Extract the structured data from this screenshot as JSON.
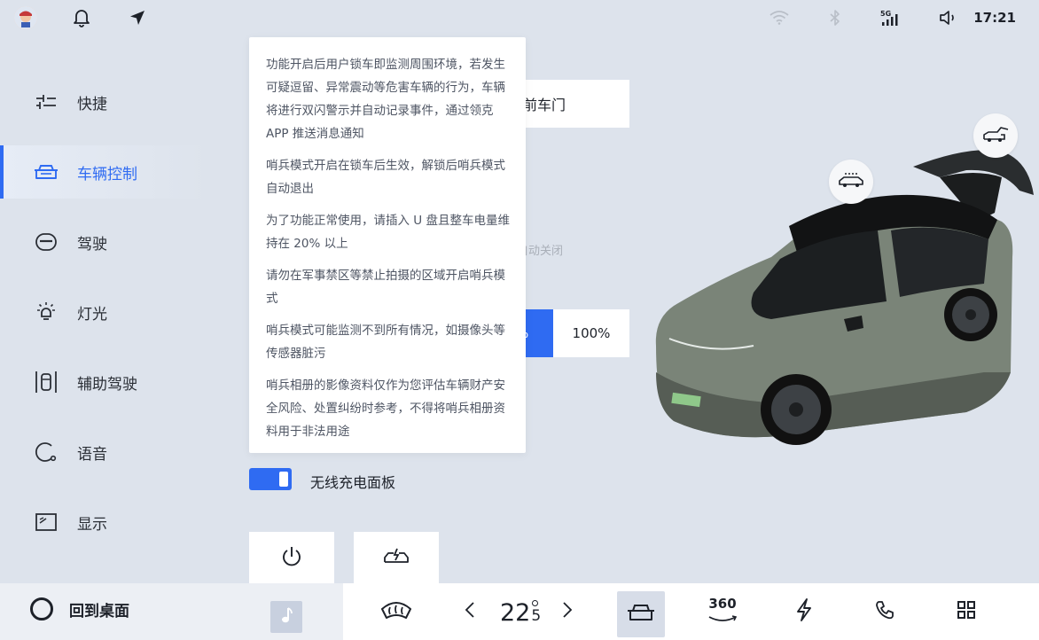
{
  "status_bar": {
    "time": "17:21",
    "signal_label": "5G"
  },
  "sidebar": {
    "items": [
      {
        "label": "快捷",
        "icon": "shortcut-sliders-icon"
      },
      {
        "label": "车辆控制",
        "icon": "car-control-icon",
        "active": true
      },
      {
        "label": "驾驶",
        "icon": "steering-wheel-icon"
      },
      {
        "label": "灯光",
        "icon": "light-bulb-icon"
      },
      {
        "label": "辅助驾驶",
        "icon": "driving-assist-icon"
      },
      {
        "label": "语音",
        "icon": "voice-icon"
      },
      {
        "label": "显示",
        "icon": "display-icon"
      }
    ]
  },
  "main": {
    "door_label": "前车门",
    "faded_text": "自动关闭",
    "segment": {
      "selected_partial": "%",
      "other": "100%"
    },
    "wireless_charging_label": "无线充电面板"
  },
  "tooltip": {
    "paragraphs": [
      "功能开启后用户锁车即监测周围环境，若发生可疑逗留、异常震动等危害车辆的行为，车辆将进行双闪警示并自动记录事件，通过领克 APP 推送消息通知",
      "哨兵模式开启在锁车后生效，解锁后哨兵模式自动退出",
      "为了功能正常使用，请插入 U 盘且整车电量维持在 20% 以上",
      "请勿在军事禁区等禁止拍摄的区域开启哨兵模式",
      "哨兵模式可能监测不到所有情况，如摄像头等传感器脏污",
      "哨兵相册的影像资料仅作为您评估车辆财产安全风险、处置纠纷时参考，不得将哨兵相册资料用于非法用途"
    ]
  },
  "dock": {
    "home_label": "回到桌面",
    "temperature_int": "22",
    "temperature_dec": "5",
    "view360_label": "360"
  },
  "colors": {
    "accent": "#2f6bf2",
    "background": "#dde3ec"
  }
}
